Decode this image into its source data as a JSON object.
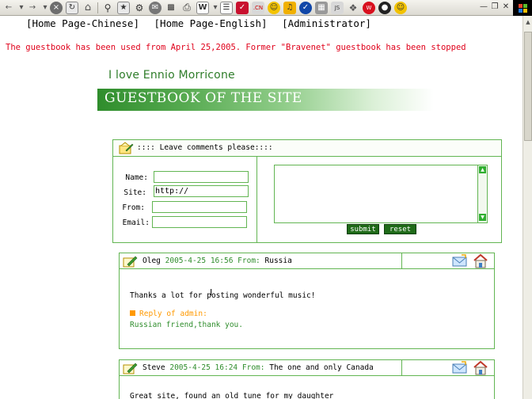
{
  "nav": {
    "links": [
      "[Home Page-Chinese]",
      "[Home Page-English]",
      "[Administrator]"
    ]
  },
  "notice": "The guestbook has been used from April 25,2005. Former \"Bravenet\" guestbook has been stopped",
  "site": {
    "name": "I love Ennio Morricone",
    "banner_title": "GUESTBOOK OF THE SITE"
  },
  "form": {
    "heading": ":::: Leave comments please::::",
    "fields": [
      {
        "label": "Name:",
        "value": ""
      },
      {
        "label": "Site:",
        "value": "http://"
      },
      {
        "label": "From:",
        "value": ""
      },
      {
        "label": "Email:",
        "value": ""
      }
    ],
    "submit_label": "submit",
    "reset_label": "reset"
  },
  "messages": [
    {
      "name": "Oleg",
      "datetime": "2005-4-25 16:56",
      "from_label": "From:",
      "from": "Russia",
      "body": "Thanks a lot for posting wonderful music!",
      "reply_label": "Reply of admin:",
      "reply": "Russian friend,thank you."
    },
    {
      "name": "Steve",
      "datetime": "2005-4-25 16:24",
      "from_label": "From:",
      "from": "The one and only Canada",
      "body": "Great site, found an old tune for my daughter"
    }
  ],
  "colors": {
    "accent_green": "#2f8d2c",
    "border_green": "#62b552",
    "notice_red": "#e0001a",
    "reply_orange": "#ff9900"
  },
  "icons": [
    "back-icon",
    "forward-icon",
    "stop-icon",
    "refresh-icon",
    "home-icon",
    "search-icon",
    "favorites-icon",
    "history-icon",
    "mail-icon",
    "print-icon",
    "edit-icon",
    "messenger-icon",
    "guestbook-pen-icon",
    "email-envelope-icon",
    "homepage-house-icon"
  ]
}
